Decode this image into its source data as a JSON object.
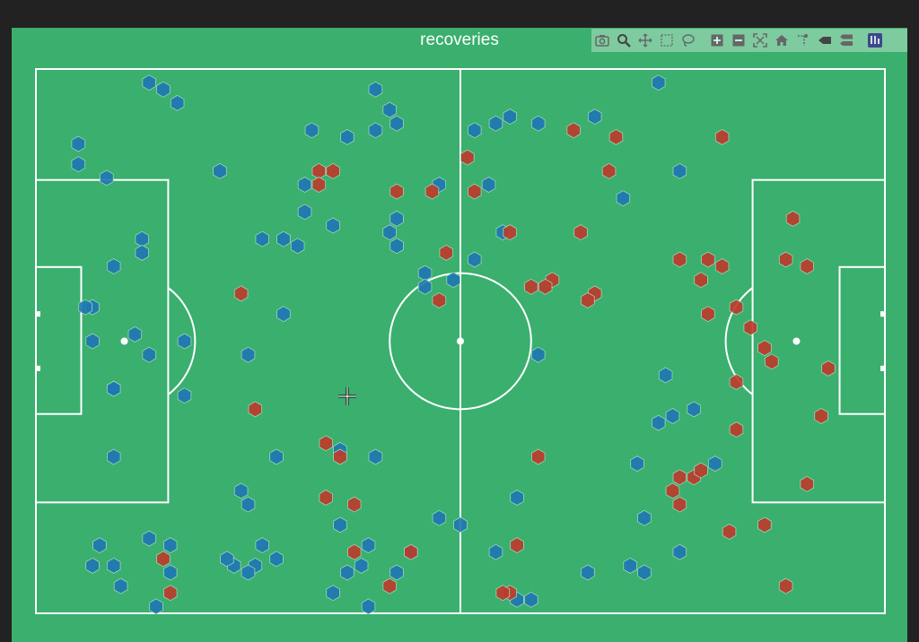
{
  "chart_data": {
    "type": "scatter",
    "title": "recoveries",
    "pitch": {
      "length": 120,
      "width": 80,
      "line_color": "#ffffff",
      "background": "#3aaf6e"
    },
    "marker": "hexagon",
    "series": [
      {
        "color": "#1f77b4",
        "points": [
          [
            16,
            2
          ],
          [
            18,
            3
          ],
          [
            20,
            5
          ],
          [
            6,
            11
          ],
          [
            6,
            14
          ],
          [
            10,
            16
          ],
          [
            26,
            15
          ],
          [
            48,
            3
          ],
          [
            50,
            6
          ],
          [
            51,
            8
          ],
          [
            39,
            9
          ],
          [
            44,
            10
          ],
          [
            48,
            9
          ],
          [
            38,
            17
          ],
          [
            38,
            21
          ],
          [
            15,
            25
          ],
          [
            15,
            27
          ],
          [
            11,
            29
          ],
          [
            8,
            35
          ],
          [
            7,
            35
          ],
          [
            8,
            40
          ],
          [
            14,
            39
          ],
          [
            21,
            40
          ],
          [
            16,
            42
          ],
          [
            21,
            48
          ],
          [
            11,
            47
          ],
          [
            30,
            42
          ],
          [
            35,
            36
          ],
          [
            32,
            25
          ],
          [
            35,
            25
          ],
          [
            37,
            26
          ],
          [
            42,
            23
          ],
          [
            51,
            22
          ],
          [
            50,
            24
          ],
          [
            51,
            26
          ],
          [
            57,
            17
          ],
          [
            55,
            30
          ],
          [
            55,
            32
          ],
          [
            59,
            31
          ],
          [
            64,
            17
          ],
          [
            66,
            24
          ],
          [
            62,
            28
          ],
          [
            62,
            9
          ],
          [
            65,
            8
          ],
          [
            67,
            7
          ],
          [
            71,
            8
          ],
          [
            79,
            7
          ],
          [
            88,
            2
          ],
          [
            83,
            19
          ],
          [
            91,
            15
          ],
          [
            71,
            42
          ],
          [
            89,
            45
          ],
          [
            93,
            50
          ],
          [
            88,
            52
          ],
          [
            90,
            51
          ],
          [
            96,
            58
          ],
          [
            85,
            58
          ],
          [
            68,
            63
          ],
          [
            86,
            66
          ],
          [
            91,
            71
          ],
          [
            86,
            74
          ],
          [
            84,
            73
          ],
          [
            78,
            74
          ],
          [
            70,
            78
          ],
          [
            68,
            78
          ],
          [
            65,
            71
          ],
          [
            60,
            67
          ],
          [
            57,
            66
          ],
          [
            53,
            71
          ],
          [
            51,
            74
          ],
          [
            47,
            70
          ],
          [
            46,
            73
          ],
          [
            44,
            74
          ],
          [
            42,
            77
          ],
          [
            47,
            79
          ],
          [
            43,
            67
          ],
          [
            34,
            72
          ],
          [
            31,
            73
          ],
          [
            30,
            74
          ],
          [
            28,
            73
          ],
          [
            32,
            70
          ],
          [
            30,
            64
          ],
          [
            29,
            62
          ],
          [
            34,
            57
          ],
          [
            43,
            56
          ],
          [
            48,
            57
          ],
          [
            27,
            72
          ],
          [
            16,
            69
          ],
          [
            19,
            70
          ],
          [
            9,
            70
          ],
          [
            8,
            73
          ],
          [
            11,
            73
          ],
          [
            19,
            74
          ],
          [
            12,
            76
          ],
          [
            17,
            79
          ],
          [
            11,
            57
          ],
          [
            11,
            47
          ]
        ]
      },
      {
        "color": "#c0392b",
        "points": [
          [
            40,
            15
          ],
          [
            42,
            15
          ],
          [
            40,
            17
          ],
          [
            51,
            18
          ],
          [
            56,
            18
          ],
          [
            61,
            13
          ],
          [
            62,
            18
          ],
          [
            76,
            9
          ],
          [
            82,
            10
          ],
          [
            81,
            15
          ],
          [
            97,
            10
          ],
          [
            77,
            24
          ],
          [
            67,
            24
          ],
          [
            70,
            32
          ],
          [
            73,
            31
          ],
          [
            79,
            33
          ],
          [
            78,
            34
          ],
          [
            72,
            32
          ],
          [
            58,
            27
          ],
          [
            57,
            34
          ],
          [
            29,
            33
          ],
          [
            31,
            50
          ],
          [
            41,
            55
          ],
          [
            43,
            57
          ],
          [
            71,
            57
          ],
          [
            41,
            63
          ],
          [
            45,
            64
          ],
          [
            90,
            62
          ],
          [
            91,
            60
          ],
          [
            93,
            60
          ],
          [
            94,
            59
          ],
          [
            91,
            64
          ],
          [
            98,
            68
          ],
          [
            103,
            67
          ],
          [
            99,
            46
          ],
          [
            103,
            41
          ],
          [
            104,
            43
          ],
          [
            101,
            38
          ],
          [
            99,
            35
          ],
          [
            95,
            36
          ],
          [
            94,
            31
          ],
          [
            97,
            29
          ],
          [
            95,
            28
          ],
          [
            91,
            28
          ],
          [
            106,
            28
          ],
          [
            109,
            29
          ],
          [
            112,
            44
          ],
          [
            111,
            51
          ],
          [
            107,
            22
          ],
          [
            109,
            61
          ],
          [
            106,
            76
          ],
          [
            99,
            53
          ],
          [
            68,
            70
          ],
          [
            67,
            77
          ],
          [
            66,
            77
          ],
          [
            53,
            71
          ],
          [
            50,
            76
          ],
          [
            45,
            71
          ],
          [
            18,
            72
          ],
          [
            19,
            77
          ]
        ]
      }
    ]
  },
  "modebar": {
    "buttons": [
      "camera-icon",
      "zoom-icon",
      "pan-icon",
      "box-select-icon",
      "lasso-icon",
      "zoom-in-icon",
      "zoom-out-icon",
      "autoscale-icon",
      "reset-icon",
      "spike-icon",
      "hover-closest-icon",
      "hover-compare-icon",
      "plotly-logo-icon"
    ]
  }
}
